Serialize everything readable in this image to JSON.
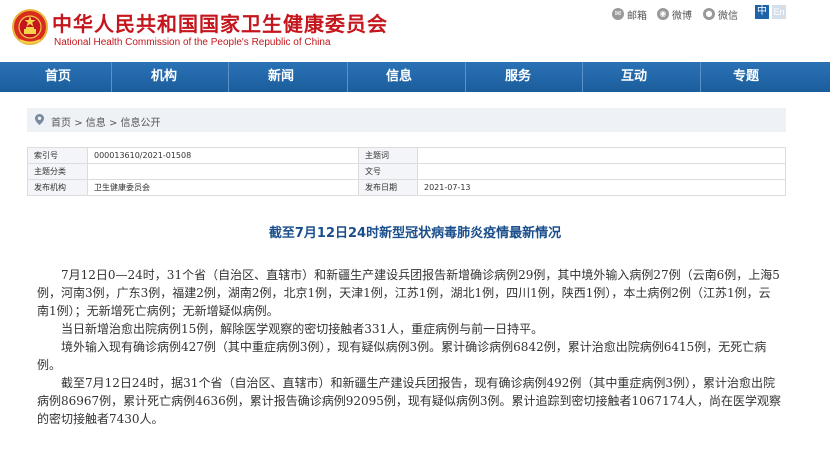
{
  "header": {
    "title": "中华人民共和国国家卫生健康委员会",
    "subtitle": "National Health Commission of the People's Republic of China",
    "share": [
      {
        "icon": "email-icon",
        "label": "邮箱"
      },
      {
        "icon": "weibo-icon",
        "label": "微博"
      },
      {
        "icon": "wechat-icon",
        "label": "微信"
      }
    ],
    "lang_zh": "中",
    "lang_en": "En"
  },
  "nav": {
    "items": [
      "首页",
      "机构",
      "新闻",
      "信息",
      "服务",
      "互动",
      "专题"
    ]
  },
  "breadcrumb": {
    "items": [
      "首页",
      "信息",
      "信息公开"
    ],
    "separator": ">"
  },
  "meta_table": {
    "rows": [
      {
        "l1": "索引号",
        "v1": "000013610/2021-01508",
        "l2": "主题词",
        "v2": ""
      },
      {
        "l1": "主题分类",
        "v1": "",
        "l2": "文号",
        "v2": ""
      },
      {
        "l1": "发布机构",
        "v1": "卫生健康委员会",
        "l2": "发布日期",
        "v2": "2021-07-13"
      }
    ]
  },
  "article": {
    "title": "截至7月12日24时新型冠状病毒肺炎疫情最新情况",
    "paragraphs": [
      "7月12日0—24时，31个省（自治区、直辖市）和新疆生产建设兵团报告新增确诊病例29例，其中境外输入病例27例（云南6例，上海5例，河南3例，广东3例，福建2例，湖南2例，北京1例，天津1例，江苏1例，湖北1例，四川1例，陕西1例），本土病例2例（江苏1例，云南1例）；无新增死亡病例；无新增疑似病例。",
      "当日新增治愈出院病例15例，解除医学观察的密切接触者331人，重症病例与前一日持平。",
      "境外输入现有确诊病例427例（其中重症病例3例），现有疑似病例3例。累计确诊病例6842例，累计治愈出院病例6415例，无死亡病例。",
      "截至7月12日24时，据31个省（自治区、直辖市）和新疆生产建设兵团报告，现有确诊病例492例（其中重症病例3例），累计治愈出院病例86967例，累计死亡病例4636例，累计报告确诊病例92095例，现有疑似病例3例。累计追踪到密切接触者1067174人，尚在医学观察的密切接触者7430人。"
    ]
  },
  "colors": {
    "brand_red": "#c4161c",
    "nav_blue": "#1b5d9c",
    "title_blue": "#1b4f8c"
  }
}
